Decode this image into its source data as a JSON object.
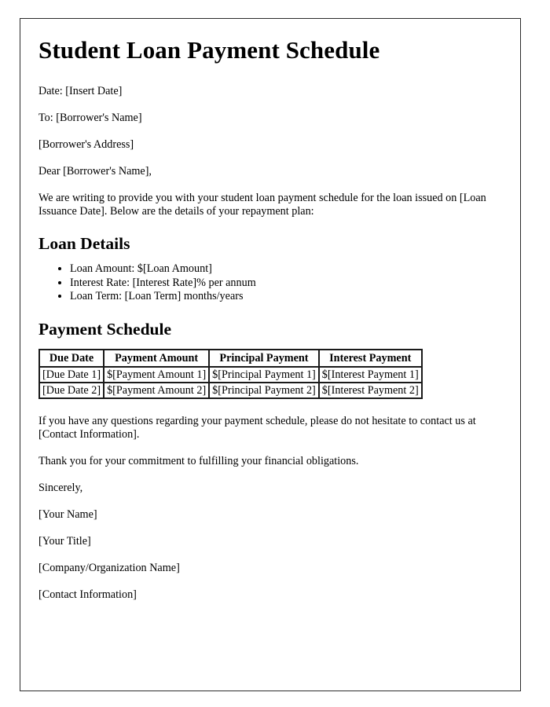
{
  "document": {
    "title": "Student Loan Payment Schedule",
    "date_line": "Date: [Insert Date]",
    "to_line": "To: [Borrower's Name]",
    "address_line": "[Borrower's Address]",
    "salutation": "Dear [Borrower's Name],",
    "intro_paragraph": "We are writing to provide you with your student loan payment schedule for the loan issued on [Loan Issuance Date]. Below are the details of your repayment plan:",
    "loan_details": {
      "heading": "Loan Details",
      "items": [
        "Loan Amount: $[Loan Amount]",
        "Interest Rate: [Interest Rate]% per annum",
        "Loan Term: [Loan Term] months/years"
      ]
    },
    "payment_schedule": {
      "heading": "Payment Schedule",
      "columns": [
        "Due Date",
        "Payment Amount",
        "Principal Payment",
        "Interest Payment"
      ],
      "rows": [
        [
          "[Due Date 1]",
          "$[Payment Amount 1]",
          "$[Principal Payment 1]",
          "$[Interest Payment 1]"
        ],
        [
          "[Due Date 2]",
          "$[Payment Amount 2]",
          "$[Principal Payment 2]",
          "$[Interest Payment 2]"
        ]
      ]
    },
    "contact_paragraph": "If you have any questions regarding your payment schedule, please do not hesitate to contact us at [Contact Information].",
    "thanks_paragraph": "Thank you for your commitment to fulfilling your financial obligations.",
    "closing": "Sincerely,",
    "signature": {
      "name": "[Your Name]",
      "title": "[Your Title]",
      "organization": "[Company/Organization Name]",
      "contact": "[Contact Information]"
    }
  },
  "colors": {
    "page_border": "#2b2b2b",
    "table_border": "#1a1a1a",
    "text": "#000000",
    "background": "#ffffff"
  }
}
